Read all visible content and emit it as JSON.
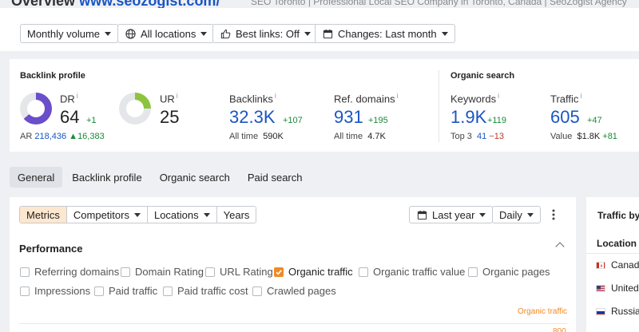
{
  "header": {
    "title_prefix": "Overview",
    "title_link": "www.seozogist.com/",
    "page_subtitle": "SEO Toronto | Professional Local SEO Company in Toronto, Canada | SeoZogist Agency"
  },
  "filters": {
    "volume": "Monthly volume",
    "locations": "All locations",
    "best_links": "Best links: Off",
    "changes": "Changes: Last month"
  },
  "backlink_profile": {
    "title": "Backlink profile",
    "dr": {
      "label": "DR",
      "info": "i",
      "value": "64",
      "delta": "+1",
      "fill_fraction": 0.64,
      "color": "#6b4ec9"
    },
    "ar": {
      "label": "AR",
      "value": "218,436",
      "delta": "16,383"
    },
    "ur": {
      "label": "UR",
      "info": "i",
      "value": "25",
      "fill_fraction": 0.25,
      "color": "#8cc43f"
    },
    "backlinks": {
      "label": "Backlinks",
      "info": "i",
      "value": "32.3K",
      "delta": "+107",
      "sub_label": "All time",
      "sub_value": "590K"
    },
    "ref_domains": {
      "label": "Ref. domains",
      "info": "i",
      "value": "931",
      "delta": "+195",
      "sub_label": "All time",
      "sub_value": "4.7K"
    }
  },
  "organic_search": {
    "title": "Organic search",
    "keywords": {
      "label": "Keywords",
      "info": "i",
      "value": "1.9K",
      "delta": "+119",
      "sub_label": "Top 3",
      "sub_value": "41",
      "sub_delta": "−13"
    },
    "traffic": {
      "label": "Traffic",
      "info": "i",
      "value": "605",
      "delta": "+47",
      "sub_label": "Value",
      "sub_value": "$1.8K",
      "sub_delta": "+81"
    }
  },
  "tabs": [
    "General",
    "Backlink profile",
    "Organic search",
    "Paid search"
  ],
  "panel": {
    "segments": [
      "Metrics",
      "Competitors",
      "Locations",
      "Years"
    ],
    "period": "Last year",
    "granularity": "Daily",
    "performance_title": "Performance",
    "checkboxes": [
      {
        "label": "Referring domains",
        "checked": false
      },
      {
        "label": "Domain Rating",
        "checked": false
      },
      {
        "label": "URL Rating",
        "checked": false
      },
      {
        "label": "Organic traffic",
        "checked": true
      },
      {
        "label": "Organic traffic value",
        "checked": false
      },
      {
        "label": "Organic pages",
        "checked": false
      },
      {
        "label": "Impressions",
        "checked": false
      },
      {
        "label": "Paid traffic",
        "checked": false
      },
      {
        "label": "Paid traffic cost",
        "checked": false
      },
      {
        "label": "Crawled pages",
        "checked": false
      }
    ],
    "series_label": "Organic traffic",
    "axis_peek": "800"
  },
  "right_panel": {
    "title": "Traffic by location",
    "location_header": "Location",
    "rows": [
      "Canada",
      "United States",
      "Russia"
    ]
  },
  "colors": {
    "accent": "#f08a24",
    "link": "#1a55c4",
    "positive": "#1a8a3a",
    "negative": "#c0392b"
  }
}
